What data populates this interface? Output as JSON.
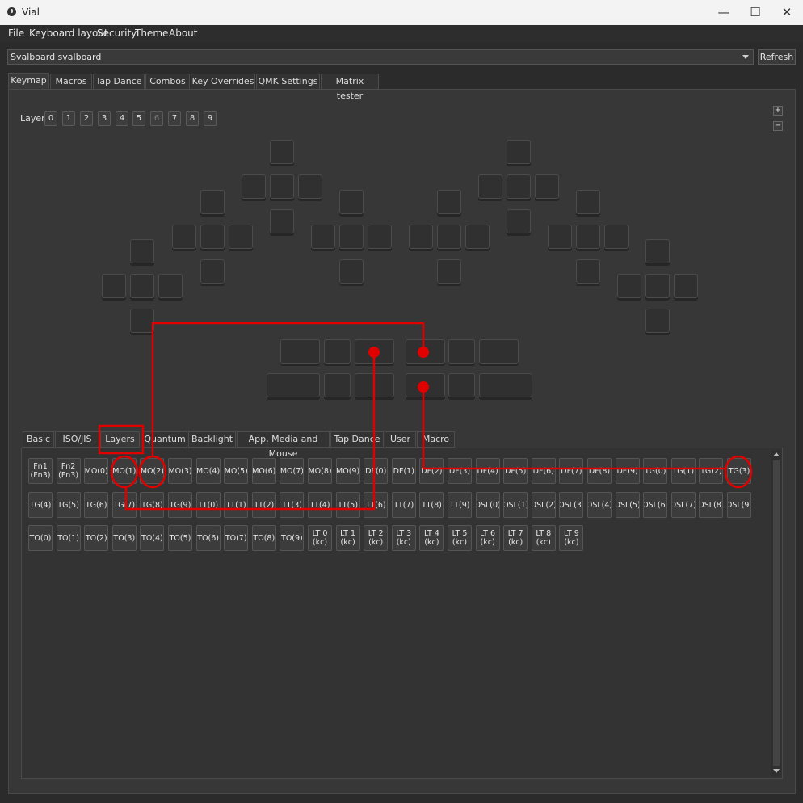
{
  "window": {
    "title": "Vial",
    "minimize_glyph": "—",
    "maximize_glyph": "☐",
    "close_glyph": "✕"
  },
  "menu": [
    "File",
    "Keyboard layout",
    "Security",
    "Theme",
    "About"
  ],
  "device": {
    "selected": "Svalboard svalboard",
    "refresh_label": "Refresh"
  },
  "main_tabs": [
    "Keymap",
    "Macros",
    "Tap Dance",
    "Combos",
    "Key Overrides",
    "QMK Settings",
    "Matrix tester"
  ],
  "layers": {
    "label": "Layer",
    "items": [
      "0",
      "1",
      "2",
      "3",
      "4",
      "5",
      "6",
      "7",
      "8",
      "9"
    ],
    "zoom_in": "+",
    "zoom_out": "−"
  },
  "key_tabs": [
    "Basic",
    "ISO/JIS",
    "Layers",
    "Quantum",
    "Backlight",
    "App, Media and Mouse",
    "Tap Dance",
    "User",
    "Macro"
  ],
  "keycodes": {
    "row1": [
      "Fn1\n(Fn3)",
      "Fn2\n(Fn3)",
      "MO(0)",
      "MO(1)",
      "MO(2)",
      "MO(3)",
      "MO(4)",
      "MO(5)",
      "MO(6)",
      "MO(7)",
      "MO(8)",
      "MO(9)",
      "DF(0)",
      "DF(1)",
      "DF(2)",
      "DF(3)",
      "DF(4)",
      "DF(5)",
      "DF(6)",
      "DF(7)",
      "DF(8)",
      "DF(9)",
      "TG(0)",
      "TG(1)",
      "TG(2)",
      "TG(3)"
    ],
    "row2": [
      "TG(4)",
      "TG(5)",
      "TG(6)",
      "TG(7)",
      "TG(8)",
      "TG(9)",
      "TT(0)",
      "TT(1)",
      "TT(2)",
      "TT(3)",
      "TT(4)",
      "TT(5)",
      "TT(6)",
      "TT(7)",
      "TT(8)",
      "TT(9)",
      "OSL(0)",
      "OSL(1)",
      "OSL(2)",
      "OSL(3)",
      "OSL(4)",
      "OSL(5)",
      "OSL(6)",
      "OSL(7)",
      "OSL(8)",
      "OSL(9)"
    ],
    "row3": [
      "TO(0)",
      "TO(1)",
      "TO(2)",
      "TO(3)",
      "TO(4)",
      "TO(5)",
      "TO(6)",
      "TO(7)",
      "TO(8)",
      "TO(9)",
      "LT 0\n(kc)",
      "LT 1\n(kc)",
      "LT 2\n(kc)",
      "LT 3\n(kc)",
      "LT 4\n(kc)",
      "LT 5\n(kc)",
      "LT 6\n(kc)",
      "LT 7\n(kc)",
      "LT 8\n(kc)",
      "LT 9\n(kc)"
    ]
  },
  "annotation_color": "#e00000"
}
